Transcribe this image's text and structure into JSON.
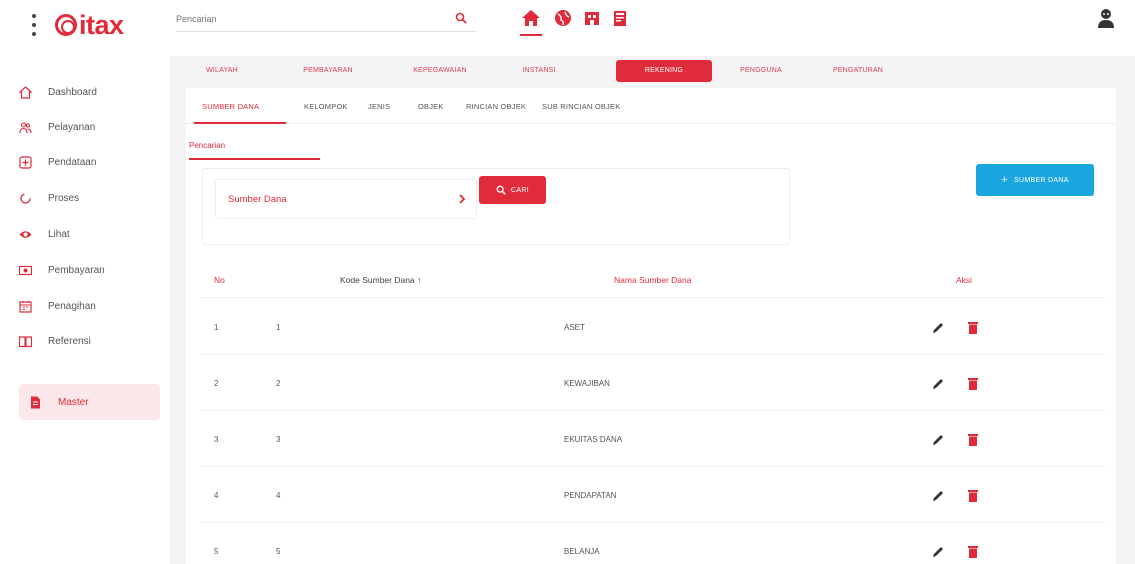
{
  "app": {
    "logo_text": "itax",
    "brand_color": "#e02b3b",
    "accent_blue": "#1ba6e0"
  },
  "search": {
    "placeholder": "Pencarian",
    "value": ""
  },
  "quick_icons": [
    "home-icon",
    "globe-icon",
    "building-icon",
    "document-icon"
  ],
  "sidebar": {
    "items": [
      {
        "label": "Dashboard",
        "icon": "home-icon"
      },
      {
        "label": "Pelayanan",
        "icon": "people-icon"
      },
      {
        "label": "Pendataan",
        "icon": "plus-box-icon"
      },
      {
        "label": "Proses",
        "icon": "loading-icon"
      },
      {
        "label": "Lihat",
        "icon": "eye-icon"
      },
      {
        "label": "Pembayaran",
        "icon": "money-icon"
      },
      {
        "label": "Penagihan",
        "icon": "calendar-icon"
      },
      {
        "label": "Referensi",
        "icon": "book-icon"
      },
      {
        "label": "Master",
        "icon": "file-icon",
        "active": true
      }
    ]
  },
  "tabs": [
    {
      "label": "WILAYAH"
    },
    {
      "label": "PEMBAYARAN"
    },
    {
      "label": "KEPEGAWAIAN"
    },
    {
      "label": "INSTANSI"
    },
    {
      "label": "REKENING",
      "active": true
    },
    {
      "label": "PENGGUNA"
    },
    {
      "label": "PENGATURAN"
    }
  ],
  "subtabs": [
    {
      "label": "SUMBER DANA",
      "active": true
    },
    {
      "label": "KELOMPOK"
    },
    {
      "label": "JENIS"
    },
    {
      "label": "OBJEK"
    },
    {
      "label": "RINCIAN OBJEK"
    },
    {
      "label": "SUB RINCIAN OBJEK"
    }
  ],
  "filter": {
    "section_label": "Pencarian",
    "select_label": "Sumber Dana",
    "cari_label": "CARI"
  },
  "add_button_label": "SUMBER DANA",
  "table": {
    "headers": {
      "no": "No",
      "kode": "Kode Sumber Dana",
      "sort_indicator": "↑",
      "nama": "Nama Sumber Dana",
      "aksi": "Aksi"
    },
    "rows": [
      {
        "no": "1",
        "kode": "1",
        "nama": "ASET"
      },
      {
        "no": "2",
        "kode": "2",
        "nama": "KEWAJIBAN"
      },
      {
        "no": "3",
        "kode": "3",
        "nama": "EKUITAS DANA"
      },
      {
        "no": "4",
        "kode": "4",
        "nama": "PENDAPATAN"
      },
      {
        "no": "5",
        "kode": "5",
        "nama": "BELANJA"
      }
    ]
  }
}
